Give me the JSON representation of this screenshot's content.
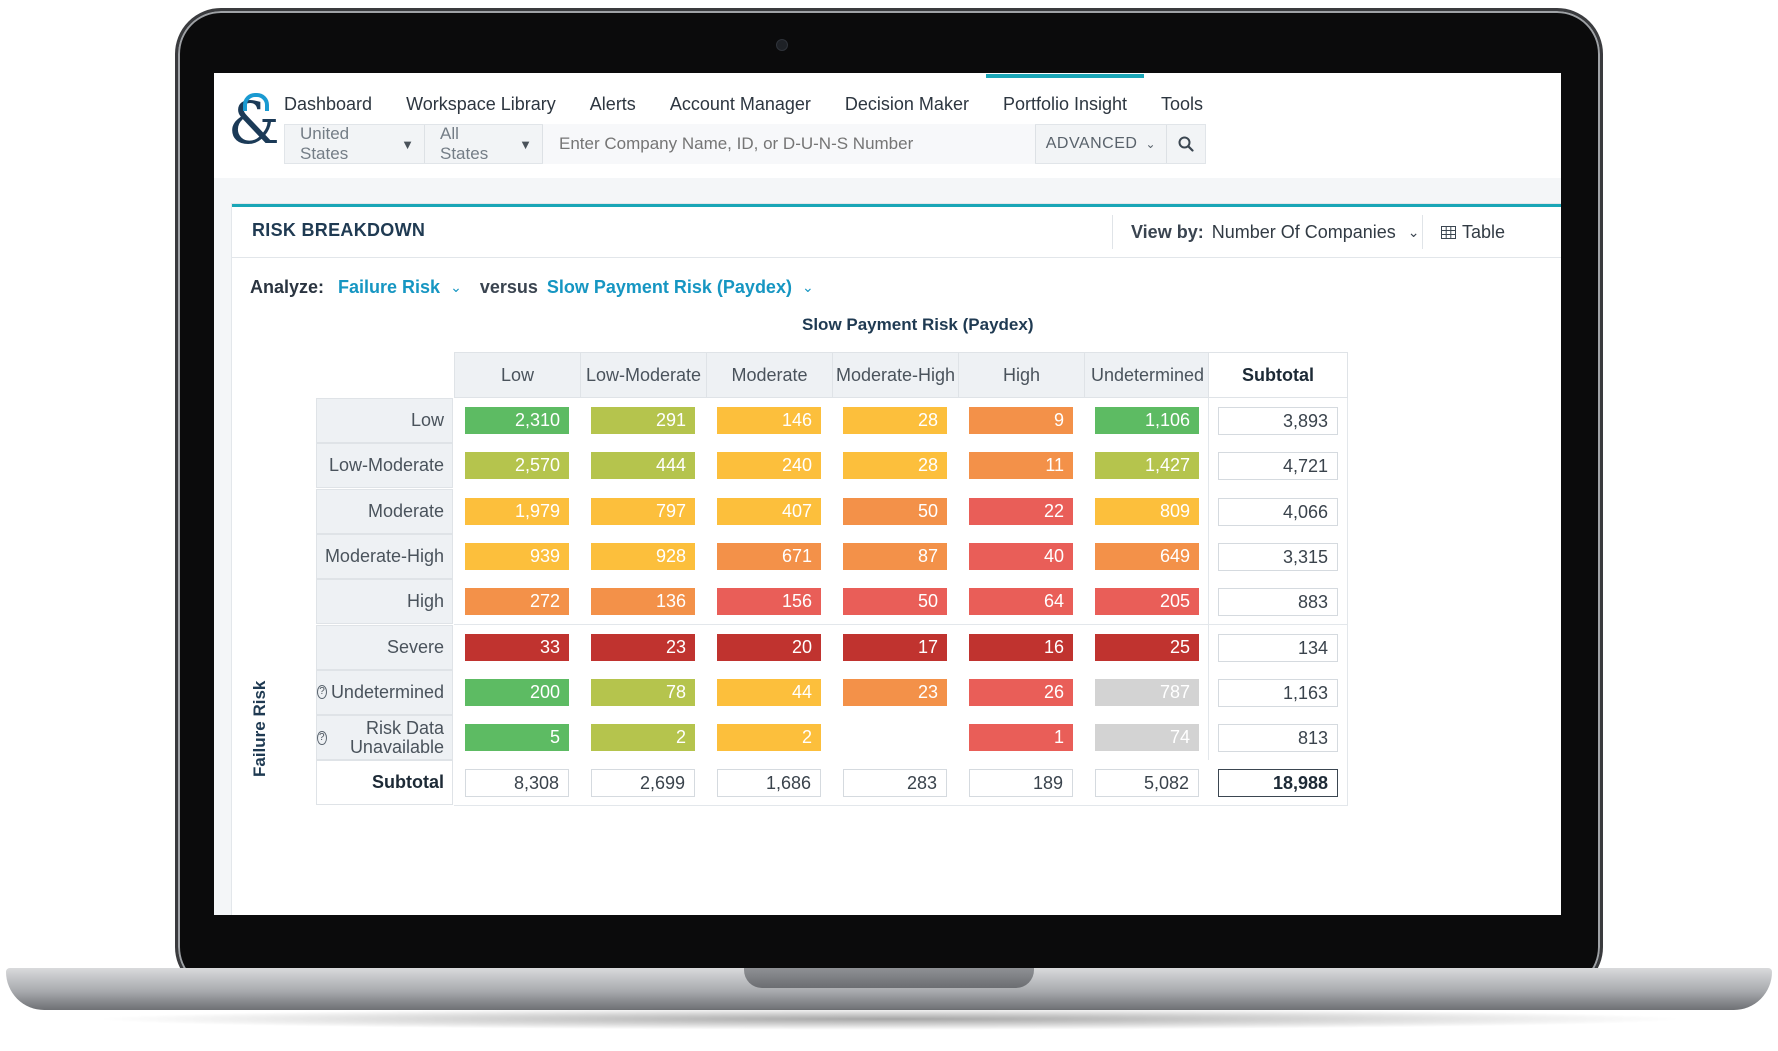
{
  "nav": {
    "items": [
      "Dashboard",
      "Workspace Library",
      "Alerts",
      "Account Manager",
      "Decision Maker",
      "Portfolio Insight",
      "Tools"
    ],
    "active": "Portfolio Insight",
    "accent_color": "#1aa6b7"
  },
  "logo": {
    "glyph": "&"
  },
  "filters": {
    "country": "United States",
    "state": "All States",
    "search_placeholder": "Enter Company Name, ID, or D-U-N-S Number",
    "advanced_label": "ADVANCED"
  },
  "card": {
    "title": "RISK BREAKDOWN",
    "view_by_label": "View by:",
    "view_by_value": "Number Of Companies",
    "table_label": "Table"
  },
  "analyze": {
    "label": "Analyze:",
    "primary": "Failure Risk",
    "versus": "versus",
    "secondary": "Slow Payment Risk (Paydex)"
  },
  "matrix": {
    "column_axis": "Slow Payment Risk (Paydex)",
    "row_axis": "Failure Risk",
    "columns": [
      "Low",
      "Low-Moderate",
      "Moderate",
      "Moderate-High",
      "High",
      "Undetermined"
    ],
    "subtotal_label": "Subtotal",
    "rows": [
      {
        "label": "Low",
        "help": false,
        "values": [
          "2,310",
          "291",
          "146",
          "28",
          "9",
          "1,106"
        ],
        "colors": [
          "green",
          "lime",
          "yellow",
          "yellow",
          "orange",
          "green"
        ],
        "subtotal": "3,893"
      },
      {
        "label": "Low-Moderate",
        "help": false,
        "values": [
          "2,570",
          "444",
          "240",
          "28",
          "11",
          "1,427"
        ],
        "colors": [
          "lime",
          "lime",
          "yellow",
          "yellow",
          "orange",
          "lime"
        ],
        "subtotal": "4,721"
      },
      {
        "label": "Moderate",
        "help": false,
        "values": [
          "1,979",
          "797",
          "407",
          "50",
          "22",
          "809"
        ],
        "colors": [
          "yellow",
          "yellow",
          "yellow",
          "orange",
          "red",
          "yellow"
        ],
        "subtotal": "4,066"
      },
      {
        "label": "Moderate-High",
        "help": false,
        "values": [
          "939",
          "928",
          "671",
          "87",
          "40",
          "649"
        ],
        "colors": [
          "yellow",
          "yellow",
          "orange",
          "orange",
          "red",
          "orange"
        ],
        "subtotal": "3,315"
      },
      {
        "label": "High",
        "help": false,
        "values": [
          "272",
          "136",
          "156",
          "50",
          "64",
          "205"
        ],
        "colors": [
          "orange",
          "orange",
          "red",
          "red",
          "red",
          "red"
        ],
        "subtotal": "883"
      },
      {
        "label": "Severe",
        "help": false,
        "values": [
          "33",
          "23",
          "20",
          "17",
          "16",
          "25"
        ],
        "colors": [
          "darkred",
          "darkred",
          "darkred",
          "darkred",
          "darkred",
          "darkred"
        ],
        "subtotal": "134"
      },
      {
        "label": "Undetermined",
        "help": true,
        "values": [
          "200",
          "78",
          "44",
          "23",
          "26",
          "787"
        ],
        "colors": [
          "green",
          "lime",
          "yellow",
          "orange",
          "red",
          "gray"
        ],
        "subtotal": "1,163"
      },
      {
        "label": "Risk Data Unavailable",
        "help": true,
        "values": [
          "5",
          "2",
          "2",
          "",
          "1",
          "74"
        ],
        "colors": [
          "green",
          "lime",
          "yellow",
          "none",
          "red",
          "gray"
        ],
        "subtotal": "813"
      }
    ],
    "column_subtotals": [
      "8,308",
      "2,699",
      "1,686",
      "283",
      "189",
      "5,082"
    ],
    "grand_total": "18,988"
  },
  "palette": {
    "green": "#5dbb63",
    "lime": "#b5c44d",
    "yellow": "#fcbf3c",
    "orange": "#f39149",
    "red": "#e95e58",
    "darkred": "#c0332f",
    "gray": "#d3d3d3"
  }
}
